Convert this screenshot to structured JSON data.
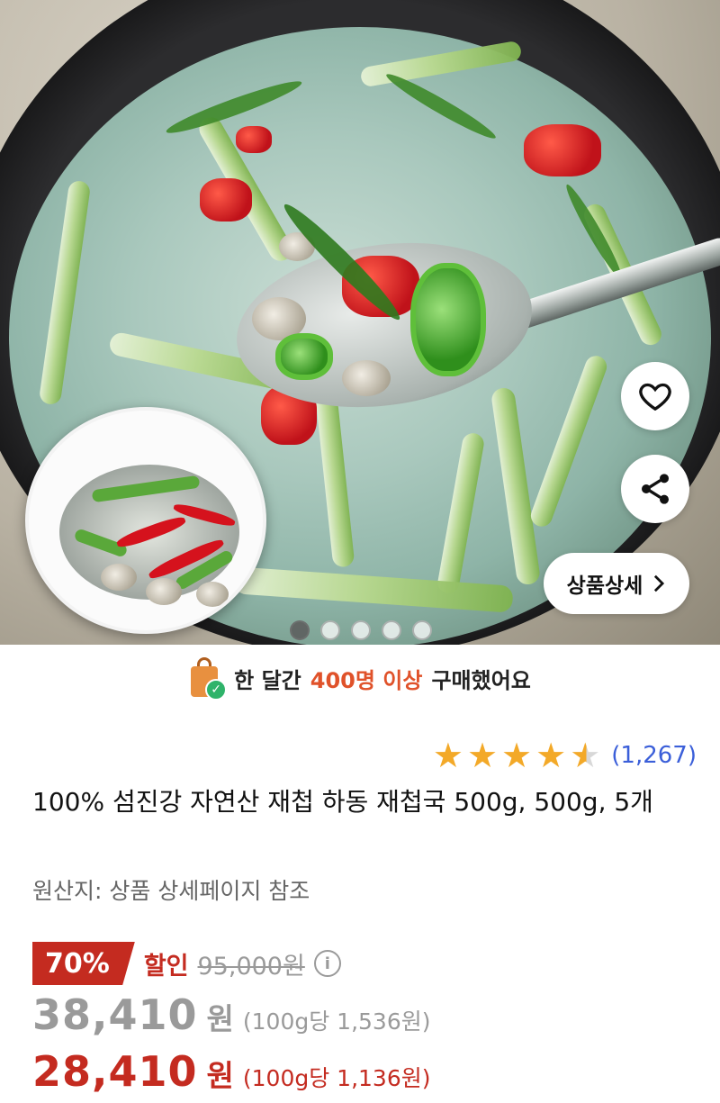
{
  "product_gallery": {
    "icons": {
      "like": "heart-icon",
      "share": "share-icon",
      "detail": "chevron-right-icon"
    },
    "detail_button_label": "상품상세",
    "slide_count": 5,
    "active_slide": 1
  },
  "purchase_banner": {
    "icon": "shopping-bag-check-icon",
    "prefix": "한 달간",
    "highlight": "400명 이상",
    "suffix": "구매했어요"
  },
  "rating": {
    "stars": 4.5,
    "review_count": "(1,267)",
    "star_color": "#f3a928"
  },
  "product": {
    "title": "100% 섬진강 자연산 재첩 하동 재첩국 500g, 500g, 5개",
    "origin": "원산지: 상품 상세페이지 참조"
  },
  "pricing": {
    "discount_badge": "70%",
    "sale_word": "할인",
    "original_price": "95,000원",
    "info_icon": "info-icon",
    "price1_amount": "38,410",
    "price1_unit": "원",
    "price1_per": "(100g당 1,536원)",
    "price2_amount": "28,410",
    "price2_unit": "원",
    "price2_per": "(100g당 1,136원)",
    "accent_color": "#c42b20"
  }
}
